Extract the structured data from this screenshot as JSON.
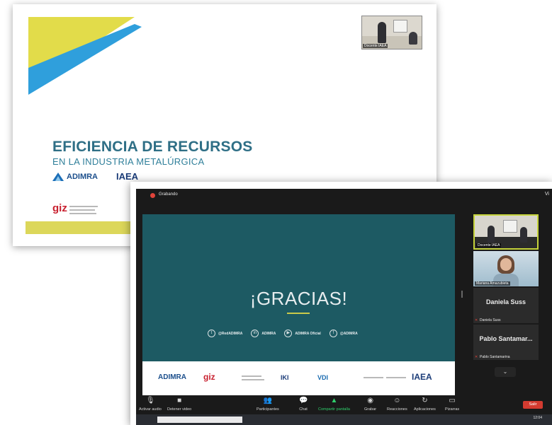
{
  "slide1": {
    "title": "EFICIENCIA DE RECURSOS",
    "subtitle": "EN LA INDUSTRIA METALÚRGICA",
    "adimra_logo": "ADIMRA",
    "iaea_logo": "IAEA",
    "giz_logo": "giz",
    "thumb_label": "Docente IAEA"
  },
  "zoom": {
    "recording_label": "Grabando",
    "view_label": "Vi",
    "share": {
      "gracias": "¡GRACIAS!",
      "socials": [
        {
          "icon": "twitter-icon",
          "glyph": "t",
          "text": "@RedADIMRA"
        },
        {
          "icon": "linkedin-icon",
          "glyph": "in",
          "text": "ADIMRA"
        },
        {
          "icon": "youtube-icon",
          "glyph": "▶",
          "text": "ADIMRA Oficial"
        },
        {
          "icon": "facebook-icon",
          "glyph": "f",
          "text": "@ADIMRA"
        }
      ],
      "logos": [
        "ADIMRA",
        "giz",
        "IKI",
        "VDI",
        "IAEA"
      ]
    },
    "participants": [
      {
        "name": "Docente IAEA",
        "type": "video",
        "active": true
      },
      {
        "name": "Mariana Amazubieta",
        "type": "video",
        "active": false
      },
      {
        "name": "Daniela Suss",
        "display": "Daniela Suss",
        "type": "name",
        "active": false
      },
      {
        "name": "Pablo Santamarina",
        "display": "Pablo Santamar...",
        "type": "name",
        "active": false
      }
    ],
    "toolbar": {
      "audio": "Activar audio",
      "video": "Detener video",
      "participants": "Participantes",
      "participants_count": "16",
      "chat": "Chat",
      "chat_badge": "3",
      "share": "Compartir pantalla",
      "record": "Grabar",
      "reactions": "Reacciones",
      "apps": "Aplicaciones",
      "whiteboard": "Pizarras",
      "leave": "Salir"
    },
    "taskbar": {
      "time": "12:04"
    },
    "colors": {
      "slide_bg": "#1d5a63",
      "accent_yellow": "#dcd75a",
      "accent_blue": "#2f9fdc",
      "share_green": "#2fd06c",
      "leave_red": "#d33b30"
    }
  }
}
